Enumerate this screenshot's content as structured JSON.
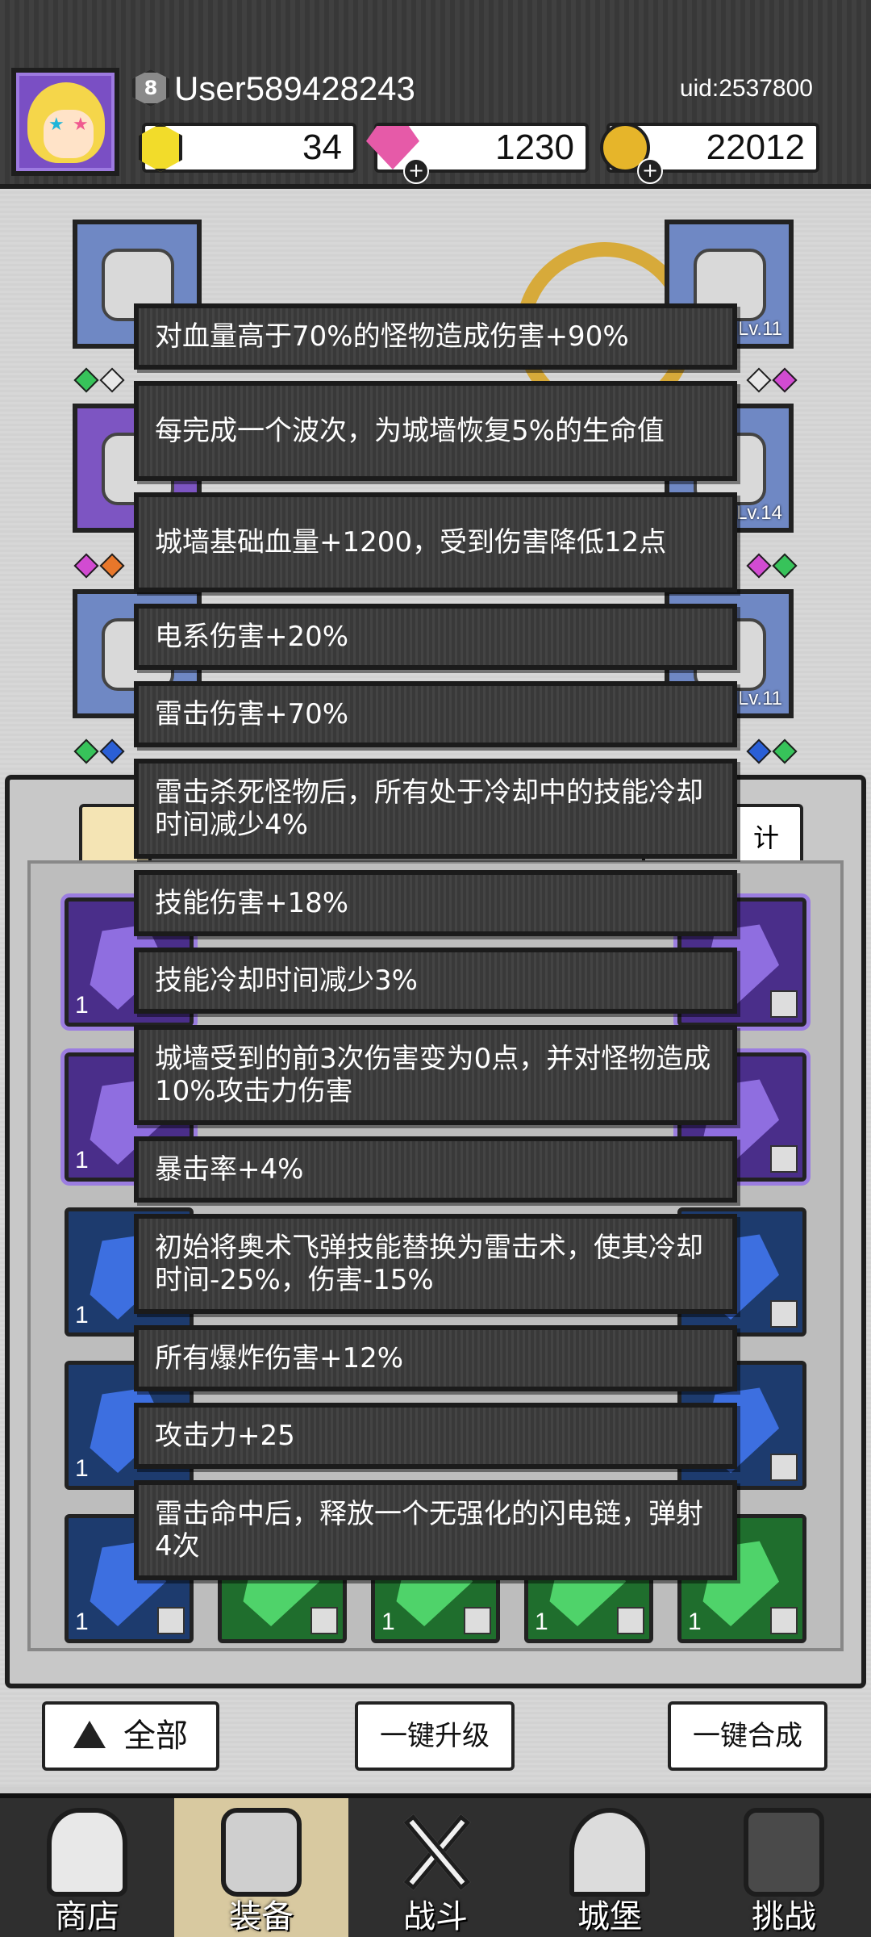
{
  "header": {
    "level": "8",
    "username": "User589428243",
    "uid": "uid:2537800",
    "currencies": {
      "energy": "34",
      "diamonds": "1230",
      "gold": "22012"
    }
  },
  "background": {
    "slot_levels": [
      "Lv.11",
      "Lv.14",
      "Lv.11"
    ],
    "crystal_qty": "1",
    "partial_tab_label": "计"
  },
  "skill_tooltips": [
    "对血量高于70%的怪物造成伤害+90%",
    "每完成一个波次，为城墙恢复5%的生命值",
    "城墙基础血量+1200，受到伤害降低12点",
    "电系伤害+20%",
    "雷击伤害+70%",
    "雷击杀死怪物后，所有处于冷却中的技能冷却时间减少4%",
    "技能伤害+18%",
    "技能冷却时间减少3%",
    "城墙受到的前3次伤害变为0点，并对怪物造成10%攻击力伤害",
    "暴击率+4%",
    "初始将奥术飞弹技能替换为雷击术，使其冷却时间-25%，伤害-15%",
    "所有爆炸伤害+12%",
    "攻击力+25",
    "雷击命中后，释放一个无强化的闪电链，弹射4次"
  ],
  "actions": {
    "all": "全部",
    "upgrade": "一键升级",
    "merge": "一键合成"
  },
  "nav": {
    "shop": "商店",
    "equipment": "装备",
    "battle": "战斗",
    "castle": "城堡",
    "challenge": "挑战"
  },
  "colors": {
    "tooltip_bg": "#3c3c3c",
    "header_bg": "#3a3a3a",
    "purple_rarity": "#7d55c2",
    "blue_rarity": "#1d3b6e",
    "green_rarity": "#1f6e2d"
  }
}
